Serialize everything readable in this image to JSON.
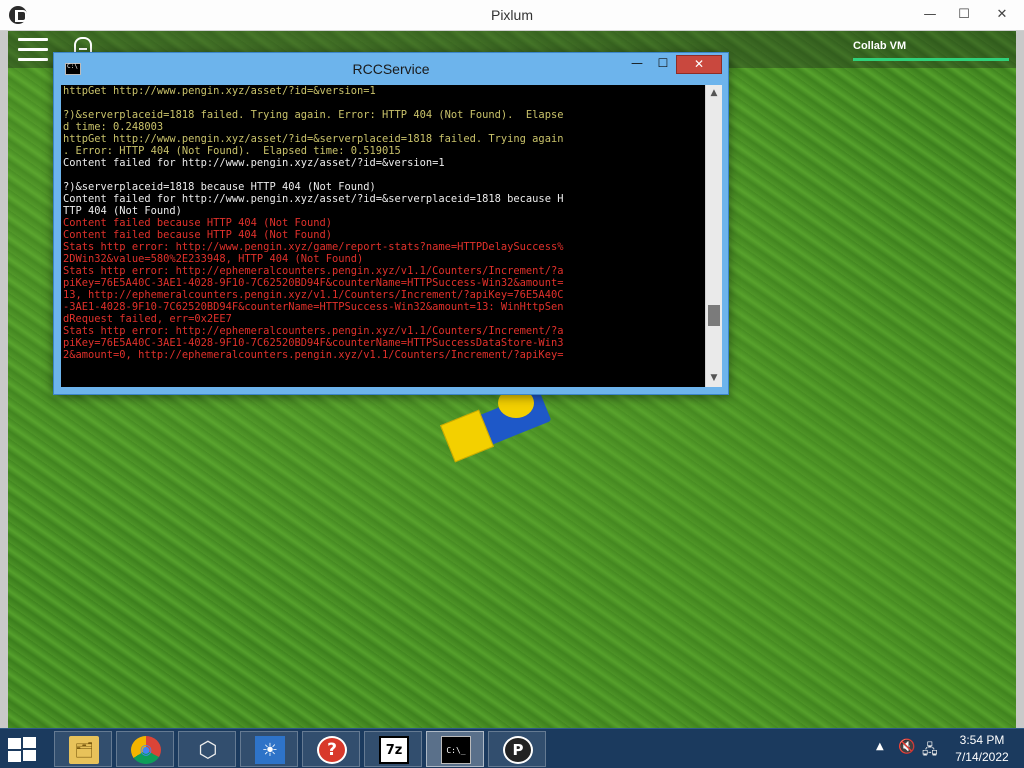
{
  "outer_window": {
    "title": "Pixlum",
    "controls": {
      "minimize": "—",
      "maximize": "☐",
      "close": "✕"
    }
  },
  "game_hud": {
    "collab_label": "Collab VM"
  },
  "console_window": {
    "title": "RCCService",
    "controls": {
      "minimize": "—",
      "maximize": "☐",
      "close": "✕"
    },
    "lines": [
      {
        "text": "httpGet http://www.pengin.xyz/asset/?id=&version=1",
        "color": "yellow"
      },
      {
        "text": "",
        "color": "yellow"
      },
      {
        "text": "?)&serverplaceid=1818 failed. Trying again. Error: HTTP 404 (Not Found).  Elapse",
        "color": "yellow"
      },
      {
        "text": "d time: 0.248003",
        "color": "yellow"
      },
      {
        "text": "httpGet http://www.pengin.xyz/asset/?id=&serverplaceid=1818 failed. Trying again",
        "color": "yellow"
      },
      {
        "text": ". Error: HTTP 404 (Not Found).  Elapsed time: 0.519015",
        "color": "yellow"
      },
      {
        "text": "Content failed for http://www.pengin.xyz/asset/?id=&version=1",
        "color": "white"
      },
      {
        "text": "",
        "color": "white"
      },
      {
        "text": "?)&serverplaceid=1818 because HTTP 404 (Not Found)",
        "color": "white"
      },
      {
        "text": "Content failed for http://www.pengin.xyz/asset/?id=&serverplaceid=1818 because H",
        "color": "white"
      },
      {
        "text": "TTP 404 (Not Found)",
        "color": "white"
      },
      {
        "text": "Content failed because HTTP 404 (Not Found)",
        "color": "red"
      },
      {
        "text": "Content failed because HTTP 404 (Not Found)",
        "color": "red"
      },
      {
        "text": "Stats http error: http://www.pengin.xyz/game/report-stats?name=HTTPDelaySuccess%",
        "color": "red"
      },
      {
        "text": "2DWin32&value=580%2E233948, HTTP 404 (Not Found)",
        "color": "red"
      },
      {
        "text": "Stats http error: http://ephemeralcounters.pengin.xyz/v1.1/Counters/Increment/?a",
        "color": "red"
      },
      {
        "text": "piKey=76E5A40C-3AE1-4028-9F10-7C62520BD94F&counterName=HTTPSuccess-Win32&amount=",
        "color": "red"
      },
      {
        "text": "13, http://ephemeralcounters.pengin.xyz/v1.1/Counters/Increment/?apiKey=76E5A40C",
        "color": "red"
      },
      {
        "text": "-3AE1-4028-9F10-7C62520BD94F&counterName=HTTPSuccess-Win32&amount=13: WinHttpSen",
        "color": "red"
      },
      {
        "text": "dRequest failed, err=0x2EE7",
        "color": "red"
      },
      {
        "text": "Stats http error: http://ephemeralcounters.pengin.xyz/v1.1/Counters/Increment/?a",
        "color": "red"
      },
      {
        "text": "piKey=76E5A40C-3AE1-4028-9F10-7C62520BD94F&counterName=HTTPSuccessDataStore-Win3",
        "color": "red"
      },
      {
        "text": "2&amount=0, http://ephemeralcounters.pengin.xyz/v1.1/Counters/Increment/?apiKey=",
        "color": "red"
      }
    ],
    "scroll_fraction": 0.82
  },
  "taskbar": {
    "apps": [
      {
        "name": "file-explorer",
        "icon": "folder-icon",
        "glyph": "🗂"
      },
      {
        "name": "chrome",
        "icon": "chrome-icon",
        "glyph": "◉"
      },
      {
        "name": "unity",
        "icon": "unity-cube-icon",
        "glyph": "⬡"
      },
      {
        "name": "brightness",
        "icon": "sun-icon",
        "glyph": "☀"
      },
      {
        "name": "help",
        "icon": "question-icon",
        "glyph": "?"
      },
      {
        "name": "7-zip",
        "icon": "7z-icon",
        "glyph": "7z"
      },
      {
        "name": "console",
        "icon": "console-icon",
        "glyph": "C:\\_"
      },
      {
        "name": "pixlum",
        "icon": "pixlum-icon",
        "glyph": "P"
      }
    ],
    "active_app": "console",
    "tray": {
      "arrow": "▲",
      "volume": "🔇",
      "network": "🖧"
    },
    "clock": {
      "time": "3:54 PM",
      "date": "7/14/2022"
    }
  },
  "colors": {
    "console_yellow": "#c9c26a",
    "console_white": "#ececec",
    "console_red": "#e0312b",
    "close_red": "#c9483e",
    "collab_green": "#2fd07a",
    "taskbar": "#1b3a5e"
  }
}
